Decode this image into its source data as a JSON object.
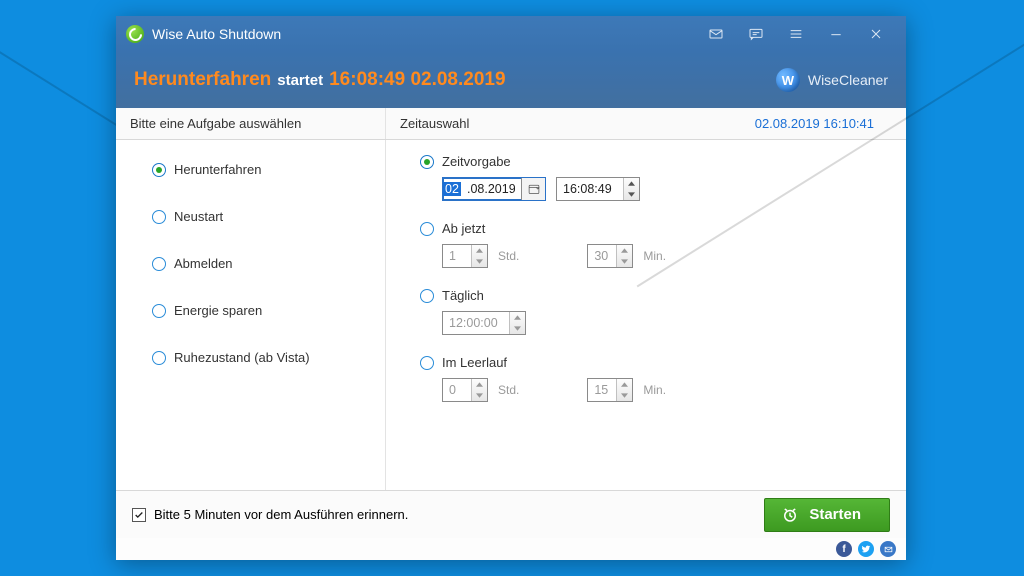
{
  "app": {
    "title": "Wise Auto Shutdown",
    "brand": "WiseCleaner"
  },
  "status": {
    "action": "Herunterfahren",
    "verb": "startet",
    "when": "16:08:49 02.08.2019"
  },
  "columns": {
    "tasks_header": "Bitte eine Aufgabe auswählen",
    "time_header": "Zeitauswahl",
    "clock": "02.08.2019 16:10:41"
  },
  "tasks": {
    "shutdown": "Herunterfahren",
    "restart": "Neustart",
    "logoff": "Abmelden",
    "energy": "Energie sparen",
    "hibernate": "Ruhezustand (ab Vista)"
  },
  "times": {
    "specified": {
      "label": "Zeitvorgabe",
      "date_seg_sel": "02",
      "date_seg_rest": ".08.2019",
      "time": "16:08:49"
    },
    "fromnow": {
      "label": "Ab jetzt",
      "hours": "1",
      "hours_unit": "Std.",
      "mins": "30",
      "mins_unit": "Min."
    },
    "daily": {
      "label": "Täglich",
      "time": "12:00:00"
    },
    "idle": {
      "label": "Im Leerlauf",
      "hours": "0",
      "hours_unit": "Std.",
      "mins": "15",
      "mins_unit": "Min."
    }
  },
  "footer": {
    "reminder": "Bitte 5 Minuten vor dem Ausführen erinnern.",
    "start": "Starten"
  }
}
